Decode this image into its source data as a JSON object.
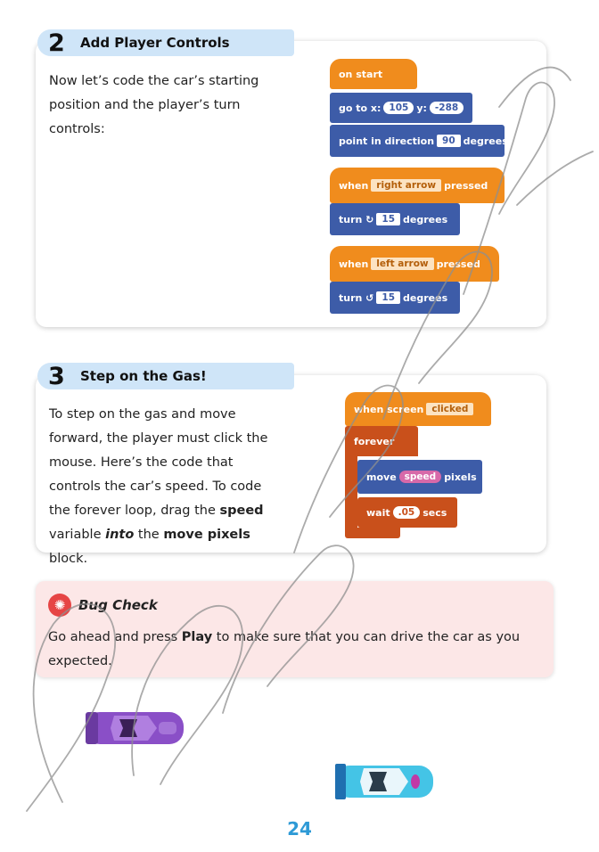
{
  "sections": [
    {
      "number": "2",
      "title": "Add Player Controls",
      "text": "Now let’s code the car’s starting position and the player’s turn controls:"
    },
    {
      "number": "3",
      "title": "Step on the Gas!",
      "text_parts": [
        "To step on the gas and move forward, the player must click the mouse. Here’s the code that controls the car’s speed. To code the forever loop, drag the ",
        "speed",
        " variable ",
        "into",
        " the ",
        "move pixels",
        " block."
      ]
    }
  ],
  "code1": {
    "on_start": "on start",
    "goto_label": "go to x:",
    "goto_x": "105",
    "goto_y_label": "y:",
    "goto_y": "-288",
    "point_label": "point in direction",
    "point_value": "90",
    "point_unit": "degrees",
    "when1": "when",
    "key1": "right arrow",
    "pressed1": "pressed",
    "turn1_label": "turn ↻",
    "turn1_value": "15",
    "turn1_unit": "degrees",
    "when2": "when",
    "key2": "left arrow",
    "pressed2": "pressed",
    "turn2_label": "turn ↺",
    "turn2_value": "15",
    "turn2_unit": "degrees"
  },
  "code2": {
    "when_screen": "when screen",
    "clicked": "clicked",
    "forever": "forever",
    "move_label": "move",
    "move_var": "speed",
    "move_unit": "pixels",
    "wait_label": "wait",
    "wait_value": ".05",
    "wait_unit": "secs"
  },
  "bug_check": {
    "title": "Bug Check",
    "text_parts": [
      "Go ahead and press ",
      "Play",
      " to make sure that you can drive the car as you expected."
    ]
  },
  "page_number": "24",
  "colors": {
    "orange": "#f08c1d",
    "blue": "#3d5ca8",
    "rust": "#c9501b",
    "tab": "#cfe5f8",
    "bug_bg": "#fce7e7",
    "page_number": "#2e9ad6"
  }
}
